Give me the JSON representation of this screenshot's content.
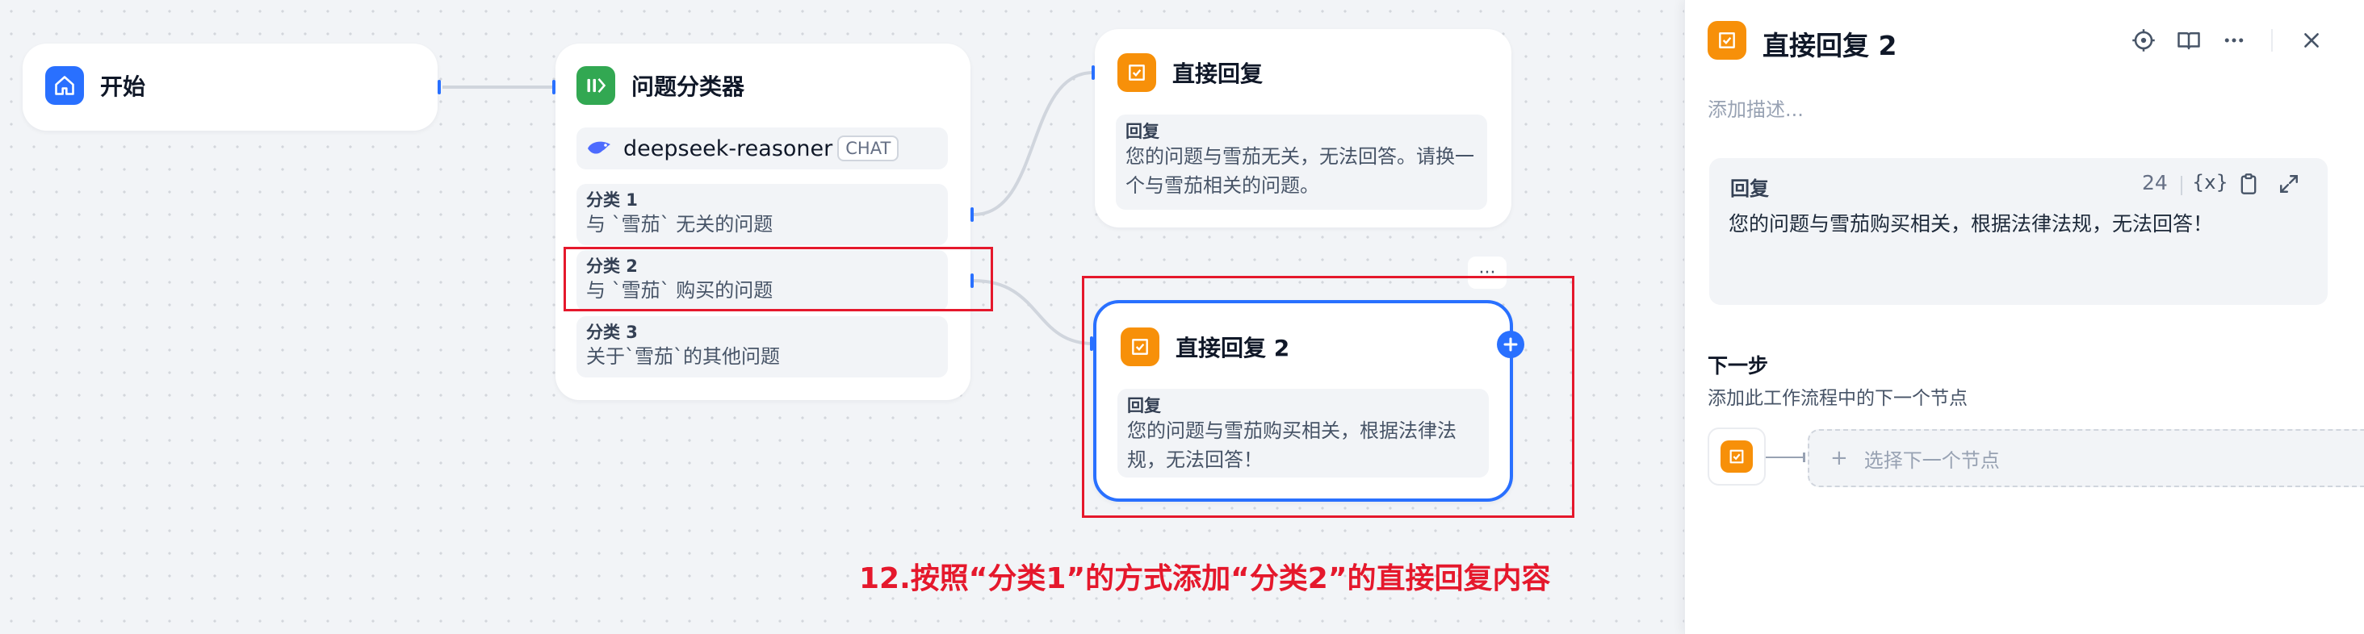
{
  "canvas": {
    "start_node": {
      "title": "开始",
      "icon": "home-icon",
      "color": "#2970ff"
    },
    "classifier_node": {
      "title": "问题分类器",
      "icon": "classifier-icon",
      "color": "#32a852",
      "model": {
        "name": "deepseek-reasoner",
        "badge": "CHAT",
        "icon": "deepseek-whale-icon"
      },
      "classes": [
        {
          "label": "分类 1",
          "text": "与 `雪茄` 无关的问题"
        },
        {
          "label": "分类 2",
          "text": "与 `雪茄` 购买的问题"
        },
        {
          "label": "分类 3",
          "text": "关于`雪茄`的其他问题"
        }
      ]
    },
    "reply_node_1": {
      "title": "直接回复",
      "icon": "reply-icon",
      "color": "#f79009",
      "reply_label": "回复",
      "reply_text": "您的问题与雪茄无关，无法回答。请换一个与雪茄相关的问题。"
    },
    "reply_node_2": {
      "title": "直接回复 2",
      "icon": "reply-icon",
      "color": "#f79009",
      "reply_label": "回复",
      "reply_text": "您的问题与雪茄购买相关，根据法律法规，无法回答！",
      "more_label": "···",
      "add_icon": "plus-icon"
    },
    "annotation": "12.按照“分类1”的方式添加“分类2”的直接回复内容",
    "accent_color": "#2970ff",
    "highlight_color": "#e5182c"
  },
  "panel": {
    "title": "直接回复 2",
    "description_placeholder": "添加描述...",
    "toolbar_icons": [
      "locate-icon",
      "book-icon",
      "more-icon",
      "close-icon"
    ],
    "reply_editor": {
      "label": "回复",
      "count": "24",
      "variable_label": "{x}",
      "text": "您的问题与雪茄购买相关，根据法律法规，无法回答！"
    },
    "next_step": {
      "title": "下一步",
      "subtitle": "添加此工作流程中的下一个节点",
      "select_label": "选择下一个节点"
    }
  }
}
